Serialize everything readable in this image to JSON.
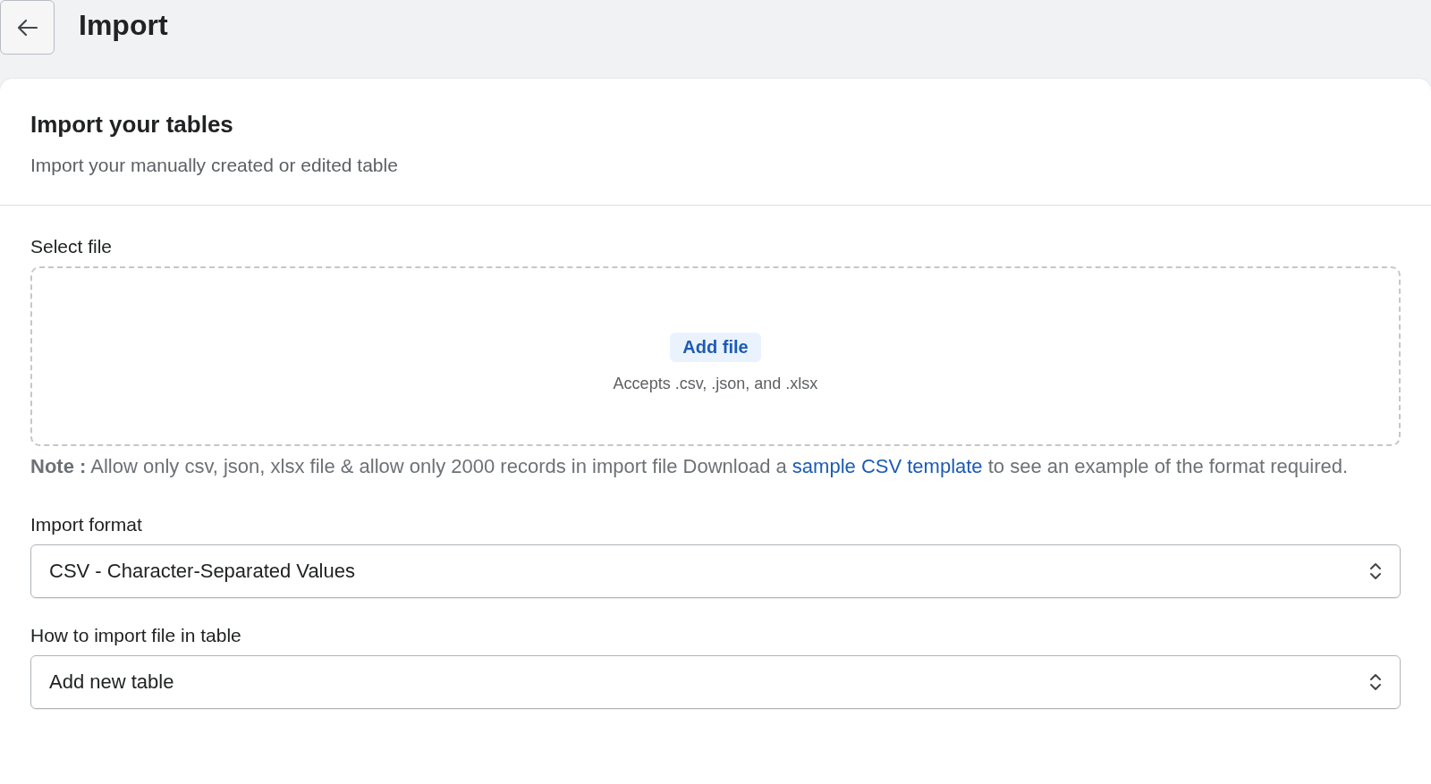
{
  "header": {
    "title": "Import"
  },
  "card": {
    "title": "Import your tables",
    "subtitle": "Import your manually created or edited table"
  },
  "file_section": {
    "label": "Select file",
    "button": "Add file",
    "hint": "Accepts .csv, .json, and .xlsx"
  },
  "note": {
    "before": "**Note :** Allow only csv, json, xlsx file & allow only 2000 records in import file Download a",
    "link": "sample CSV template",
    "after": "to see an example of the format required."
  },
  "fields": [
    {
      "label": "Import format",
      "value": "CSV - Character-Separated Values"
    },
    {
      "label": "How to import file in table",
      "value": "Add new table"
    }
  ]
}
